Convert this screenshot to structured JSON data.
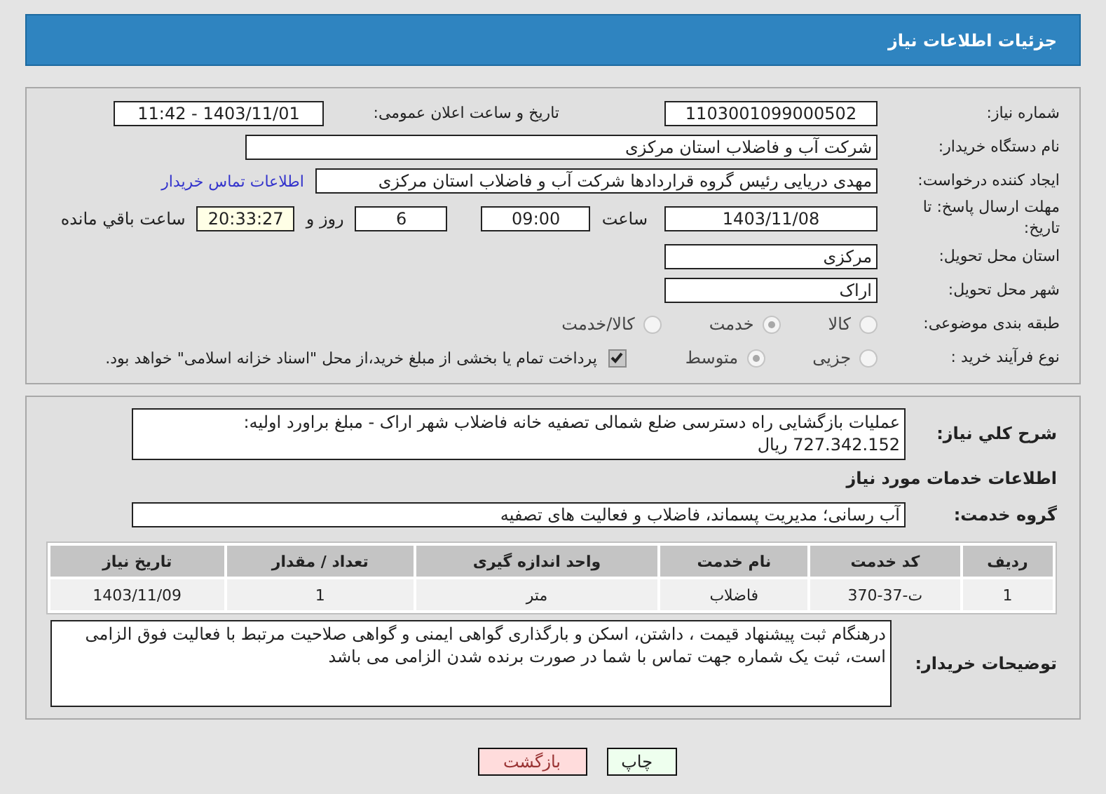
{
  "header": {
    "title": "جزئیات اطلاعات نیاز"
  },
  "need_number": {
    "label": "شماره نیاز:",
    "value": "1103001099000502"
  },
  "announce": {
    "label": "تاریخ و ساعت اعلان عمومی:",
    "value": "1403/11/01 - 11:42"
  },
  "buyer": {
    "label": "نام دستگاه خریدار:",
    "value": "شرکت آب و فاضلاب استان مرکزی"
  },
  "requester": {
    "label": "ایجاد کننده درخواست:",
    "value": "مهدی دریایی رئیس گروه قراردادها شرکت آب و فاضلاب استان مرکزی",
    "link": "اطلاعات تماس خریدار"
  },
  "deadline": {
    "label": "مهلت ارسال پاسخ: تا تاریخ:",
    "date": "1403/11/08",
    "time_label": "ساعت",
    "time": "09:00",
    "days": "6",
    "days_label": "روز و",
    "remaining": "20:33:27",
    "remaining_label": "ساعت باقي مانده"
  },
  "province": {
    "label": "استان محل تحویل:",
    "value": "مرکزی"
  },
  "city": {
    "label": "شهر محل تحویل:",
    "value": "اراک"
  },
  "category": {
    "label": "طبقه بندی موضوعی:",
    "options": [
      {
        "label": "کالا",
        "selected": false
      },
      {
        "label": "خدمت",
        "selected": true
      },
      {
        "label": "کالا/خدمت",
        "selected": false
      }
    ]
  },
  "process": {
    "label": "نوع فرآیند خرید :",
    "options": [
      {
        "label": "جزیی",
        "selected": false
      },
      {
        "label": "متوسط",
        "selected": true
      }
    ],
    "treasury": {
      "checked": true,
      "label": "پرداخت تمام یا بخشی از مبلغ خرید،از محل \"اسناد خزانه اسلامی\" خواهد بود."
    }
  },
  "description": {
    "label": "شرح کلي نیاز:",
    "value": "عملیات بازگشایی راه دسترسی ضلع شمالی تصفیه خانه فاضلاب شهر اراک - مبلغ براورد اولیه: 727.342.152 ریال"
  },
  "services_title": "اطلاعات خدمات مورد نیاز",
  "service_group": {
    "label": "گروه خدمت:",
    "value": "آب رسانی؛ مدیریت پسماند، فاضلاب و فعالیت های تصفیه"
  },
  "table": {
    "columns": [
      "ردیف",
      "کد خدمت",
      "نام خدمت",
      "واحد اندازه گیری",
      "تعداد / مقدار",
      "تاریخ نیاز"
    ],
    "rows": [
      [
        "1",
        "ت-37-370",
        "فاضلاب",
        "متر",
        "1",
        "1403/11/09"
      ]
    ]
  },
  "buyer_notes": {
    "label": "توضیحات خریدار:",
    "value": "درهنگام ثبت پیشنهاد قیمت ، داشتن، اسکن و بارگذاری گواهی ایمنی و گواهی صلاحیت مرتبط با فعالیت فوق الزامی است، ثبت یک شماره جهت تماس با شما در صورت برنده شدن الزامی می باشد"
  },
  "buttons": [
    {
      "label": "چاپ",
      "kind": "print"
    },
    {
      "label": "بازگشت",
      "kind": "back"
    }
  ]
}
